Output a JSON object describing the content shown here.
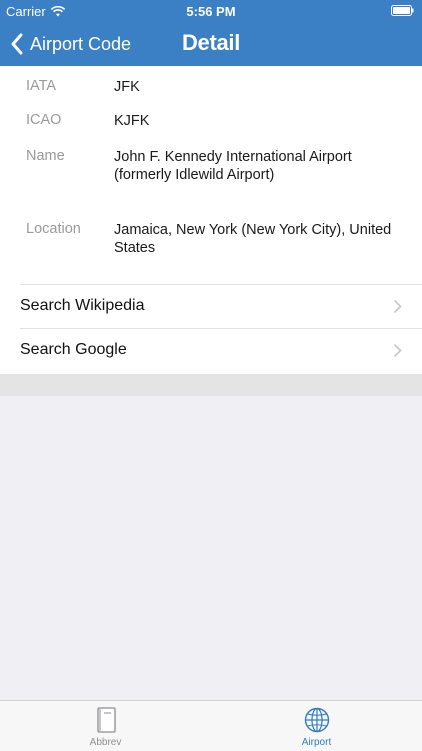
{
  "status_bar": {
    "carrier": "Carrier",
    "time": "5:56 PM"
  },
  "nav": {
    "back_label": "Airport Code",
    "title": "Detail"
  },
  "details": [
    {
      "label": "IATA",
      "value": "JFK"
    },
    {
      "label": "ICAO",
      "value": "KJFK"
    },
    {
      "label": "Name",
      "value": "John F. Kennedy International Airport (formerly Idlewild Airport)"
    },
    {
      "label": "Location",
      "value": "Jamaica, New York (New York City), United States"
    }
  ],
  "links": [
    {
      "label": "Search Wikipedia"
    },
    {
      "label": "Search Google"
    }
  ],
  "tabs": [
    {
      "label": "Abbrev",
      "icon": "book-icon",
      "selected": false
    },
    {
      "label": "Airport",
      "icon": "globe-icon",
      "selected": true
    }
  ],
  "colors": {
    "accent": "#3b7fc4",
    "tab_selected": "#2f7bc4",
    "tab_unselected": "#8e8e93"
  }
}
